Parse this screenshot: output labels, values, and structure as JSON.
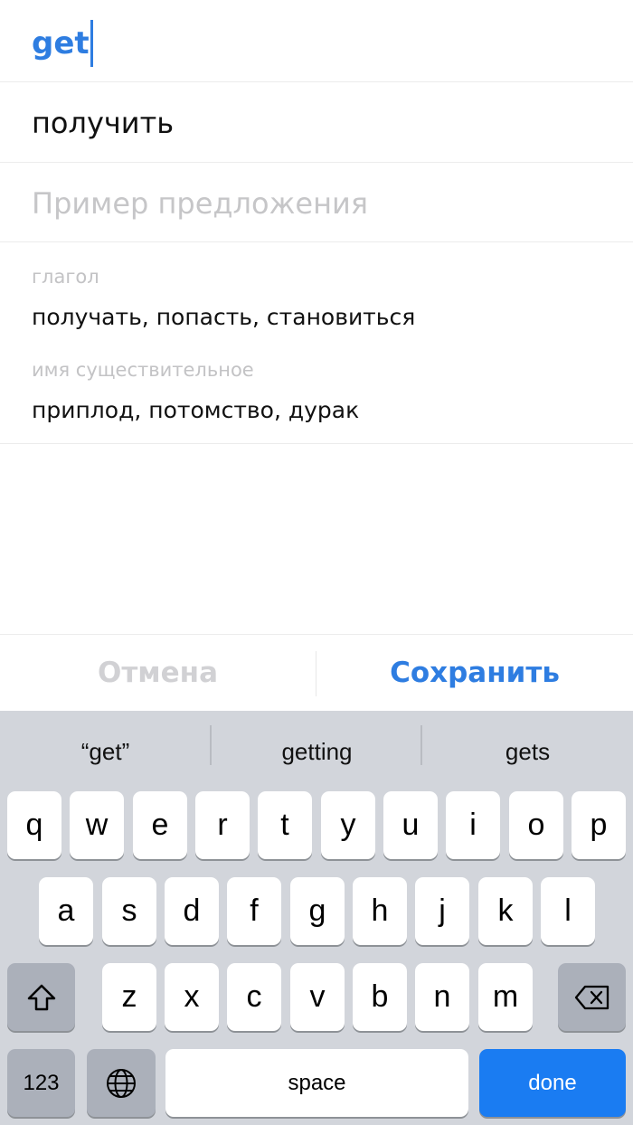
{
  "entry": {
    "word": "get",
    "translation": "получить",
    "example_placeholder": "Пример предложения",
    "groups": [
      {
        "pos": "глагол",
        "words": "получать, попасть, становиться"
      },
      {
        "pos": "имя существительное",
        "words": "приплод, потомство, дурак"
      }
    ]
  },
  "actions": {
    "cancel": "Отмена",
    "save": "Сохранить"
  },
  "keyboard": {
    "suggestions": [
      "“get”",
      "getting",
      "gets"
    ],
    "row1": [
      "q",
      "w",
      "e",
      "r",
      "t",
      "y",
      "u",
      "i",
      "o",
      "p"
    ],
    "row2": [
      "a",
      "s",
      "d",
      "f",
      "g",
      "h",
      "j",
      "k",
      "l"
    ],
    "row3": [
      "z",
      "x",
      "c",
      "v",
      "b",
      "n",
      "m"
    ],
    "numbers_label": "123",
    "space_label": "space",
    "done_label": "done"
  },
  "colors": {
    "accent": "#2e7de1",
    "done_key": "#1a7cf2"
  }
}
